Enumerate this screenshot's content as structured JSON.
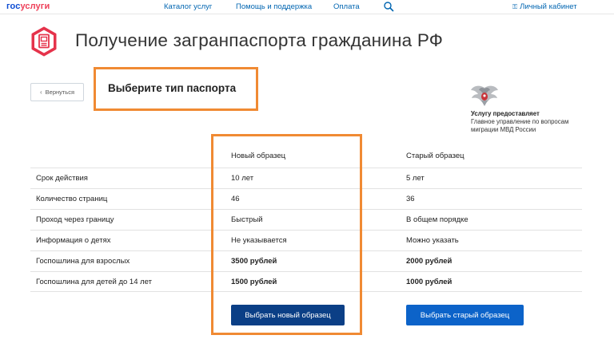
{
  "header": {
    "logo_part1": "гос",
    "logo_part2": "услуги",
    "nav": [
      "Каталог услуг",
      "Помощь и поддержка",
      "Оплата"
    ],
    "cabinet_label": "Личный кабинет"
  },
  "page": {
    "title": "Получение загранпаспорта гражданина РФ",
    "back_label": "Вернуться",
    "subtitle": "Выберите тип паспорта"
  },
  "provider": {
    "label": "Услугу предоставляет",
    "name": "Главное управление по вопросам миграции МВД России"
  },
  "table": {
    "columns": [
      "Новый образец",
      "Старый образец"
    ],
    "rows": [
      {
        "label": "Срок действия",
        "new": "10 лет",
        "old": "5 лет"
      },
      {
        "label": "Количество страниц",
        "new": "46",
        "old": "36"
      },
      {
        "label": "Проход через границу",
        "new": "Быстрый",
        "old": "В общем порядке"
      },
      {
        "label": "Информация о детях",
        "new": "Не указывается",
        "old": "Можно указать"
      },
      {
        "label": "Госпошлина для взрослых",
        "new": "3500 рублей",
        "old": "2000 рублей"
      },
      {
        "label": "Госпошлина для детей до 14 лет",
        "new": "1500 рублей",
        "old": "1000 рублей"
      }
    ]
  },
  "buttons": {
    "choose_new": "Выбрать новый образец",
    "choose_old": "Выбрать старый образец"
  },
  "colors": {
    "accent_blue": "#0065b1",
    "logo_red": "#ee3f58",
    "button_dark": "#0b3f86",
    "button_blue": "#0c63c9",
    "highlight_orange": "#f08a33",
    "icon_red": "#e5334b"
  },
  "icons": [
    "search-icon",
    "key-icon",
    "passport-icon",
    "chevron-left-icon",
    "mvd-emblem-icon"
  ]
}
